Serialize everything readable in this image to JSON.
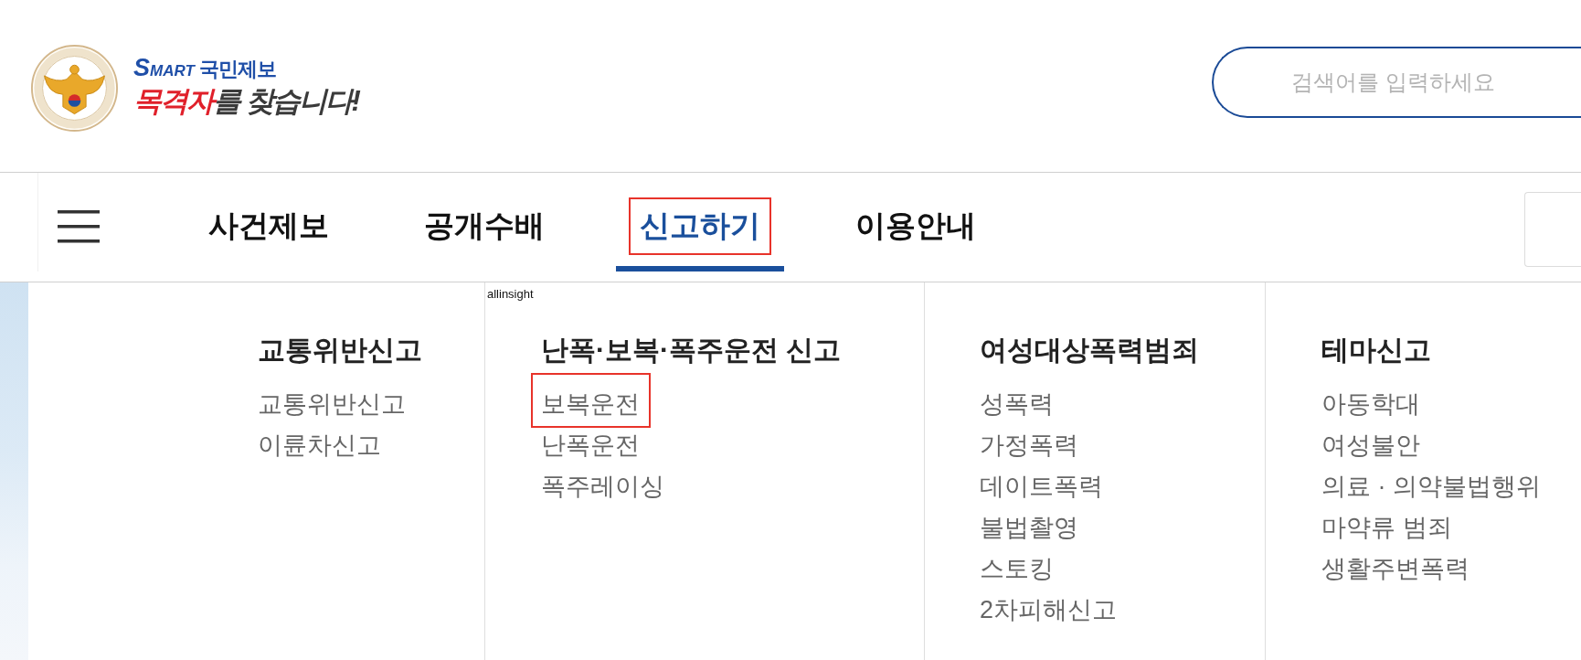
{
  "header": {
    "logo": {
      "brand_prefix": "SMART",
      "brand_name": "국민제보",
      "slogan_highlight": "목격자",
      "slogan_rest": "를 찾습니다!"
    },
    "search": {
      "placeholder": "검색어를 입력하세요"
    }
  },
  "nav": {
    "tabs": [
      {
        "label": "사건제보",
        "selected": false,
        "highlighted": false
      },
      {
        "label": "공개수배",
        "selected": false,
        "highlighted": false
      },
      {
        "label": "신고하기",
        "selected": true,
        "highlighted": true
      },
      {
        "label": "이용안내",
        "selected": false,
        "highlighted": false
      }
    ]
  },
  "menu": {
    "corner_note": "allinsight",
    "columns": [
      {
        "heading": "교통위반신고",
        "items": [
          {
            "label": "교통위반신고",
            "highlighted": false
          },
          {
            "label": "이륜차신고",
            "highlighted": false
          }
        ]
      },
      {
        "heading": "난폭·보복·폭주운전 신고",
        "items": [
          {
            "label": "보복운전",
            "highlighted": true
          },
          {
            "label": "난폭운전",
            "highlighted": false
          },
          {
            "label": "폭주레이싱",
            "highlighted": false
          }
        ]
      },
      {
        "heading": "여성대상폭력범죄",
        "items": [
          {
            "label": "성폭력",
            "highlighted": false
          },
          {
            "label": "가정폭력",
            "highlighted": false
          },
          {
            "label": "데이트폭력",
            "highlighted": false
          },
          {
            "label": "불법촬영",
            "highlighted": false
          },
          {
            "label": "스토킹",
            "highlighted": false
          },
          {
            "label": "2차피해신고",
            "highlighted": false
          }
        ]
      },
      {
        "heading": "테마신고",
        "items": [
          {
            "label": "아동학대",
            "highlighted": false
          },
          {
            "label": "여성불안",
            "highlighted": false
          },
          {
            "label": "의료 · 의약불법행위",
            "highlighted": false
          },
          {
            "label": "마약류 범죄",
            "highlighted": false
          },
          {
            "label": "생활주변폭력",
            "highlighted": false
          }
        ]
      }
    ]
  }
}
